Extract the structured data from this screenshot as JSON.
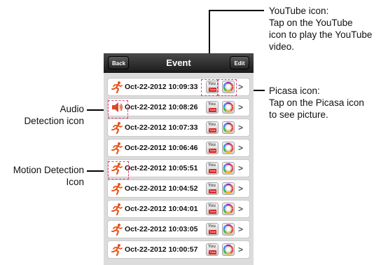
{
  "annotations": {
    "youtube": [
      "YouTube icon:",
      "Tap on the YouTube",
      "icon to play the YouTube",
      "video."
    ],
    "picasa": [
      "Picasa icon:",
      "Tap on the Picasa icon",
      "to see picture."
    ],
    "audio": [
      "Audio",
      "Detection icon"
    ],
    "motion": [
      "Motion Detection",
      "Icon"
    ]
  },
  "navbar": {
    "title": "Event",
    "back_label": "Back",
    "edit_label": "Edit"
  },
  "events": [
    {
      "type": "motion",
      "datetime": "Oct-22-2012 10:09:33"
    },
    {
      "type": "audio",
      "datetime": "Oct-22-2012 10:08:26"
    },
    {
      "type": "motion",
      "datetime": "Oct-22-2012 10:07:33"
    },
    {
      "type": "motion",
      "datetime": "Oct-22-2012 10:06:46"
    },
    {
      "type": "motion",
      "datetime": "Oct-22-2012 10:05:51"
    },
    {
      "type": "motion",
      "datetime": "Oct-22-2012 10:04:52"
    },
    {
      "type": "motion",
      "datetime": "Oct-22-2012 10:04:01"
    },
    {
      "type": "motion",
      "datetime": "Oct-22-2012 10:03:05"
    },
    {
      "type": "motion",
      "datetime": "Oct-22-2012 10:00:57"
    }
  ],
  "icons": {
    "youtube_text_top": "You",
    "youtube_text_bottom": "Tube",
    "chevron": ">"
  },
  "colors": {
    "highlight": "#e0407a",
    "motion_icon": "#e8551e",
    "audio_icon": "#d94a2a",
    "youtube_red": "#dd2222"
  }
}
